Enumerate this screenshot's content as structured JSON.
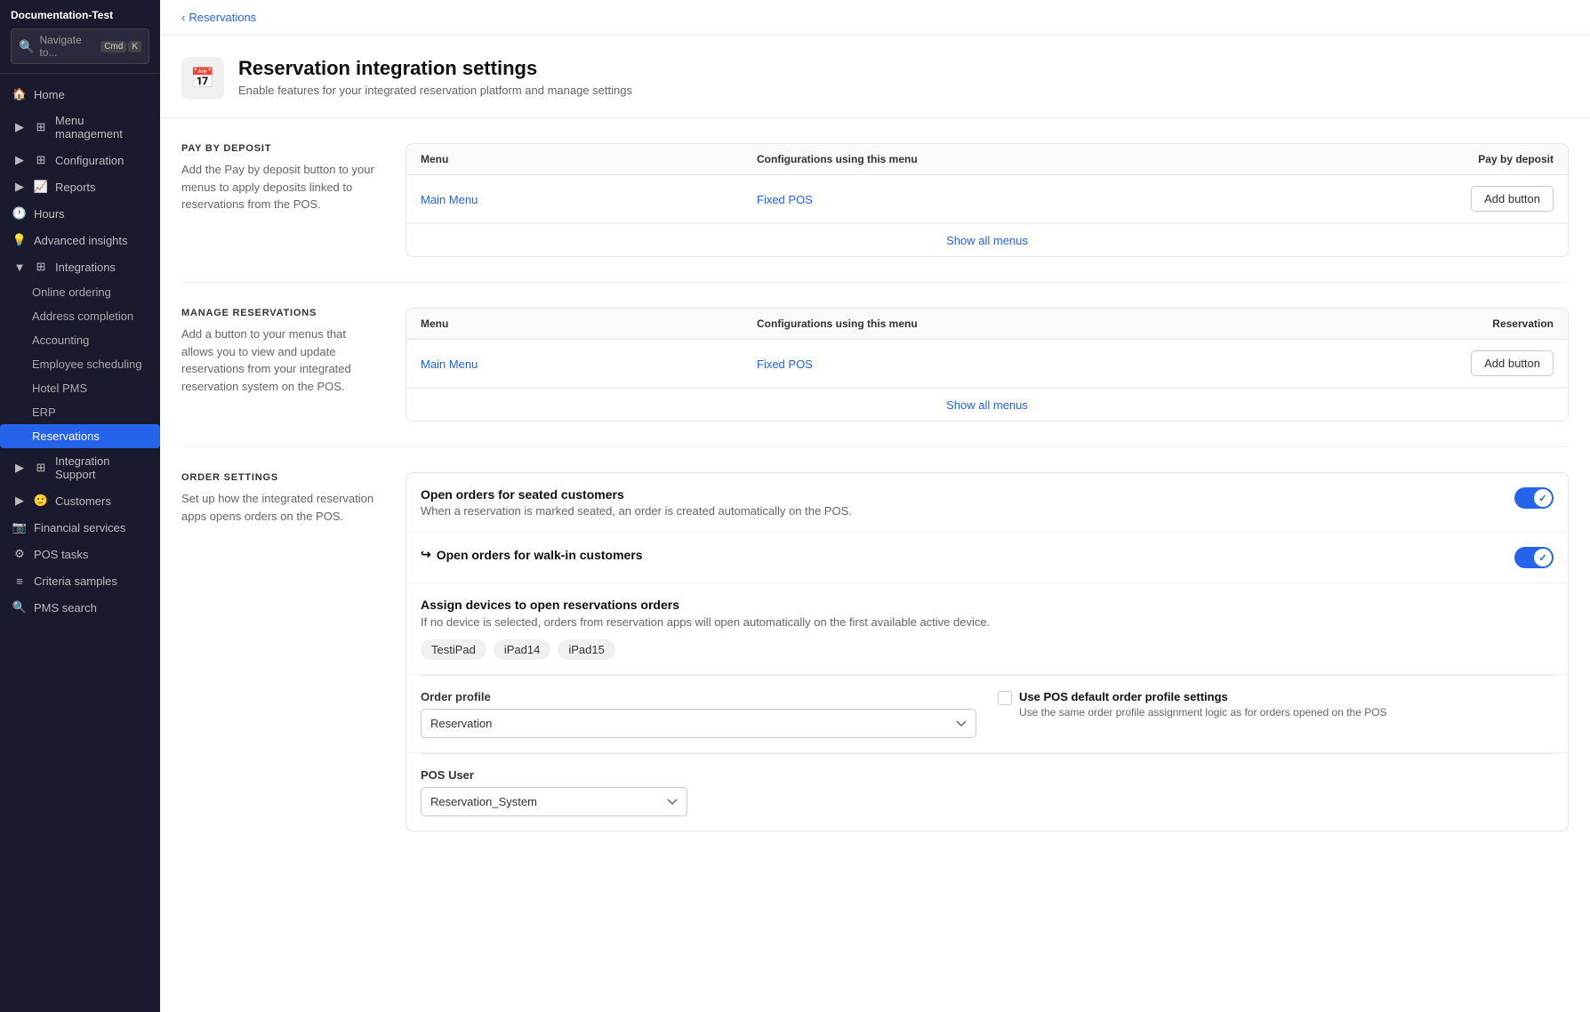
{
  "app": {
    "title": "Documentation-Test"
  },
  "nav_search": {
    "text": "Navigate to...",
    "cmd": "Cmd",
    "k": "K"
  },
  "sidebar": {
    "items": [
      {
        "id": "home",
        "label": "Home",
        "icon": "home-icon",
        "active": false,
        "hasChevron": false
      },
      {
        "id": "menu-management",
        "label": "Menu management",
        "icon": "menu-icon",
        "active": false,
        "hasChevron": true
      },
      {
        "id": "configuration",
        "label": "Configuration",
        "icon": "config-icon",
        "active": false,
        "hasChevron": true
      },
      {
        "id": "reports",
        "label": "Reports",
        "icon": "reports-icon",
        "active": false,
        "hasChevron": true
      },
      {
        "id": "hours",
        "label": "Hours",
        "icon": "hours-icon",
        "active": false,
        "hasChevron": false
      },
      {
        "id": "advanced-insights",
        "label": "Advanced insights",
        "icon": "insights-icon",
        "active": false,
        "hasChevron": false
      },
      {
        "id": "integrations",
        "label": "Integrations",
        "icon": "integrations-icon",
        "active": false,
        "hasChevron": true,
        "expanded": true
      }
    ],
    "sub_items": [
      {
        "id": "online-ordering",
        "label": "Online ordering",
        "active": false
      },
      {
        "id": "address-completion",
        "label": "Address completion",
        "active": false
      },
      {
        "id": "accounting",
        "label": "Accounting",
        "active": false
      },
      {
        "id": "employee-scheduling",
        "label": "Employee scheduling",
        "active": false
      },
      {
        "id": "hotel-pms",
        "label": "Hotel PMS",
        "active": false
      },
      {
        "id": "erp",
        "label": "ERP",
        "active": false
      },
      {
        "id": "reservations",
        "label": "Reservations",
        "active": true
      }
    ],
    "bottom_items": [
      {
        "id": "integration-support",
        "label": "Integration Support",
        "icon": "support-icon",
        "hasChevron": true
      },
      {
        "id": "customers",
        "label": "Customers",
        "icon": "customers-icon",
        "hasChevron": true
      },
      {
        "id": "financial-services",
        "label": "Financial services",
        "icon": "financial-icon",
        "hasChevron": false
      },
      {
        "id": "pos-tasks",
        "label": "POS tasks",
        "icon": "pos-icon",
        "hasChevron": false
      },
      {
        "id": "criteria-samples",
        "label": "Criteria samples",
        "icon": "criteria-icon",
        "hasChevron": false
      },
      {
        "id": "pms-search",
        "label": "PMS search",
        "icon": "pms-icon",
        "hasChevron": false
      }
    ]
  },
  "breadcrumb": {
    "label": "Reservations"
  },
  "page": {
    "title": "Reservation integration settings",
    "subtitle": "Enable features for your integrated reservation platform and manage settings"
  },
  "pay_by_deposit": {
    "section_label": "PAY BY DEPOSIT",
    "section_desc": "Add the Pay by deposit button to your menus to apply deposits linked to reservations from the POS.",
    "table": {
      "col_menu": "Menu",
      "col_config": "Configurations using this menu",
      "col_action": "Pay by deposit",
      "rows": [
        {
          "menu": "Main Menu",
          "config": "Fixed POS",
          "action": "Add button"
        }
      ],
      "show_all": "Show all menus"
    }
  },
  "manage_reservations": {
    "section_label": "MANAGE RESERVATIONS",
    "section_desc": "Add a button to your menus that allows you to view and update reservations from your integrated reservation system on the POS.",
    "table": {
      "col_menu": "Menu",
      "col_config": "Configurations using this menu",
      "col_action": "Reservation",
      "rows": [
        {
          "menu": "Main Menu",
          "config": "Fixed POS",
          "action": "Add button"
        }
      ],
      "show_all": "Show all menus"
    }
  },
  "order_settings": {
    "section_label": "ORDER SETTINGS",
    "section_desc": "Set up how the integrated reservation apps opens orders on the POS.",
    "open_orders_seated": {
      "title": "Open orders for seated customers",
      "desc": "When a reservation is marked seated, an order is created automatically on the POS.",
      "enabled": true
    },
    "open_orders_walkin": {
      "title": "Open orders for walk-in customers",
      "enabled": true
    },
    "assign_devices": {
      "title": "Assign devices to open reservations orders",
      "desc": "If no device is selected, orders from reservation apps will open automatically on the first available active device.",
      "devices": [
        "TestiPad",
        "iPad14",
        "iPad15"
      ]
    },
    "order_profile": {
      "label": "Order profile",
      "value": "Reservation",
      "options": [
        "Reservation"
      ],
      "use_default_label": "Use POS default order profile settings",
      "use_default_desc": "Use the same order profile assignment logic as for orders opened on the POS"
    },
    "pos_user": {
      "label": "POS User",
      "value": "Reservation_System",
      "options": [
        "Reservation_System"
      ]
    }
  },
  "colors": {
    "accent": "#2563eb",
    "active_nav": "#2563eb",
    "sidebar_bg": "#1a1a2e",
    "toggle_on": "#2563eb"
  }
}
